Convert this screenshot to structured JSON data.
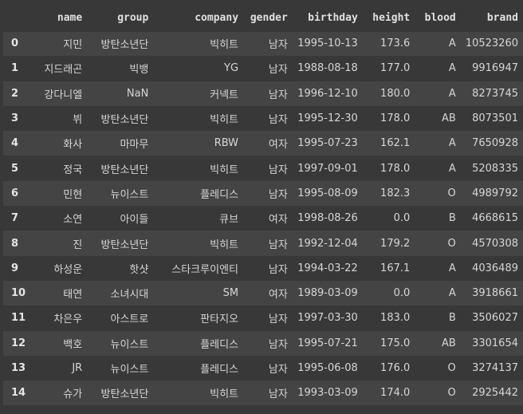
{
  "columns": [
    "",
    "name",
    "group",
    "company",
    "gender",
    "birthday",
    "height",
    "blood",
    "brand"
  ],
  "rows": [
    [
      "0",
      "지민",
      "방탄소년단",
      "빅히트",
      "남자",
      "1995-10-13",
      "173.6",
      "A",
      "10523260"
    ],
    [
      "1",
      "지드래곤",
      "빅뱅",
      "YG",
      "남자",
      "1988-08-18",
      "177.0",
      "A",
      "9916947"
    ],
    [
      "2",
      "강다니엘",
      "NaN",
      "커넥트",
      "남자",
      "1996-12-10",
      "180.0",
      "A",
      "8273745"
    ],
    [
      "3",
      "뷔",
      "방탄소년단",
      "빅히트",
      "남자",
      "1995-12-30",
      "178.0",
      "AB",
      "8073501"
    ],
    [
      "4",
      "화사",
      "마마무",
      "RBW",
      "여자",
      "1995-07-23",
      "162.1",
      "A",
      "7650928"
    ],
    [
      "5",
      "정국",
      "방탄소년단",
      "빅히트",
      "남자",
      "1997-09-01",
      "178.0",
      "A",
      "5208335"
    ],
    [
      "6",
      "민현",
      "뉴이스트",
      "플레디스",
      "남자",
      "1995-08-09",
      "182.3",
      "O",
      "4989792"
    ],
    [
      "7",
      "소연",
      "아이들",
      "큐브",
      "여자",
      "1998-08-26",
      "0.0",
      "B",
      "4668615"
    ],
    [
      "8",
      "진",
      "방탄소년단",
      "빅히트",
      "남자",
      "1992-12-04",
      "179.2",
      "O",
      "4570308"
    ],
    [
      "9",
      "하성운",
      "핫샷",
      "스타크루이엔티",
      "남자",
      "1994-03-22",
      "167.1",
      "A",
      "4036489"
    ],
    [
      "10",
      "태연",
      "소녀시대",
      "SM",
      "여자",
      "1989-03-09",
      "0.0",
      "A",
      "3918661"
    ],
    [
      "11",
      "차은우",
      "아스트로",
      "판타지오",
      "남자",
      "1997-03-30",
      "183.0",
      "B",
      "3506027"
    ],
    [
      "12",
      "백호",
      "뉴이스트",
      "플레디스",
      "남자",
      "1995-07-21",
      "175.0",
      "AB",
      "3301654"
    ],
    [
      "13",
      "JR",
      "뉴이스트",
      "플레디스",
      "남자",
      "1995-06-08",
      "176.0",
      "O",
      "3274137"
    ],
    [
      "14",
      "슈가",
      "방탄소년단",
      "빅히트",
      "남자",
      "1993-03-09",
      "174.0",
      "O",
      "2925442"
    ]
  ]
}
